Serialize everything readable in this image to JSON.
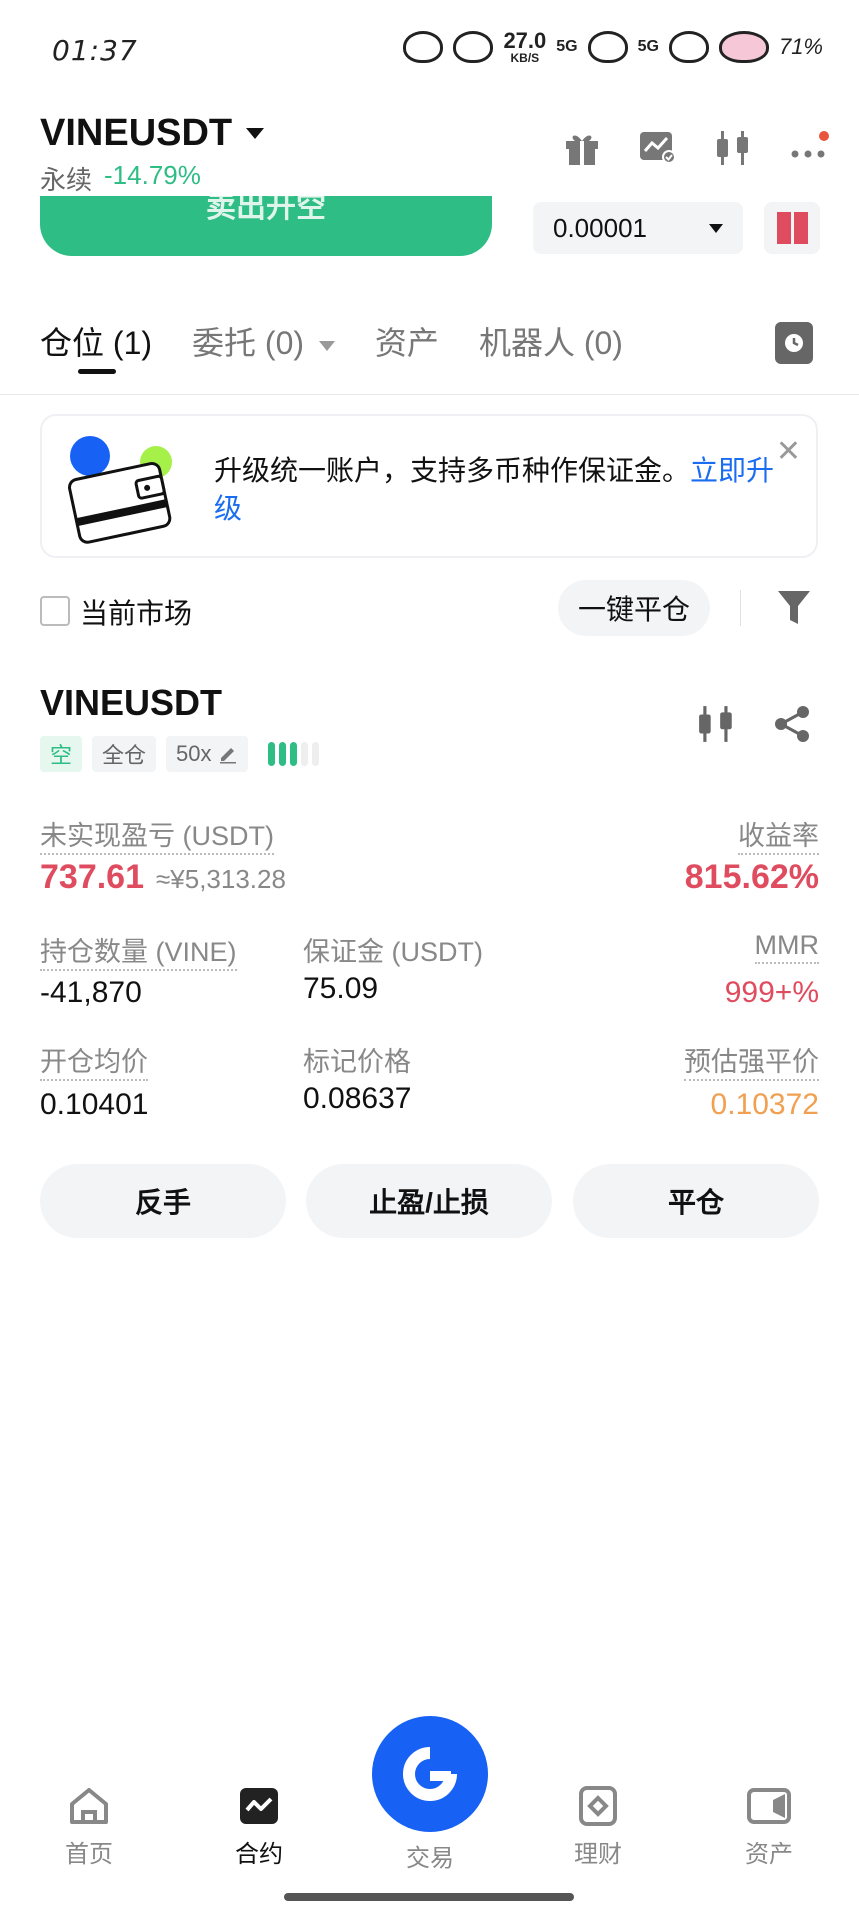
{
  "status_bar": {
    "time": "01:37",
    "net_speed": "27.0",
    "net_unit": "KB/S",
    "signal1": "5G",
    "signal2": "5G",
    "battery": "71%"
  },
  "header": {
    "symbol": "VINEUSDT",
    "contract_type": "永续",
    "change": "-14.79%",
    "icons": [
      "gift-icon",
      "chart-check-icon",
      "candlestick-icon",
      "more-icon"
    ]
  },
  "order_bar": {
    "sell_label": "卖出开空",
    "quantity_value": "0.00001"
  },
  "tabs": [
    {
      "label": "仓位",
      "count": "(1)"
    },
    {
      "label": "委托",
      "count": "(0)"
    },
    {
      "label": "资产",
      "count": ""
    },
    {
      "label": "机器人",
      "count": "(0)"
    }
  ],
  "banner": {
    "text": "升级统一账户，支持多币种作保证金。",
    "link": "立即升级"
  },
  "filter_row": {
    "checkbox_label": "当前市场",
    "close_all_label": "一键平仓"
  },
  "position": {
    "symbol": "VINEUSDT",
    "side_tag": "空",
    "margin_mode_tag": "全仓",
    "leverage_tag": "50x",
    "leverage_level": 0.6,
    "unrealized_pnl_label": "未实现盈亏 (USDT)",
    "unrealized_pnl": "737.61",
    "unrealized_pnl_cny": "≈¥5,313.28",
    "roe_label": "收益率",
    "roe": "815.62%",
    "size_label": "持仓数量 (VINE)",
    "size": "-41,870",
    "margin_label": "保证金 (USDT)",
    "margin": "75.09",
    "mmr_label": "MMR",
    "mmr": "999+%",
    "entry_label": "开仓均价",
    "entry": "0.10401",
    "mark_label": "标记价格",
    "mark": "0.08637",
    "liq_label": "预估强平价",
    "liq": "0.10372"
  },
  "actions": {
    "reverse": "反手",
    "tpsl": "止盈/止损",
    "close": "平仓"
  },
  "bottom_nav": {
    "home": "首页",
    "futures": "合约",
    "trade": "交易",
    "earn": "理财",
    "assets": "资产"
  },
  "colors": {
    "green": "#2ebd85",
    "red": "#e04c5f",
    "orange": "#f0a050",
    "blue": "#1762f5",
    "link": "#1a6cf0"
  }
}
